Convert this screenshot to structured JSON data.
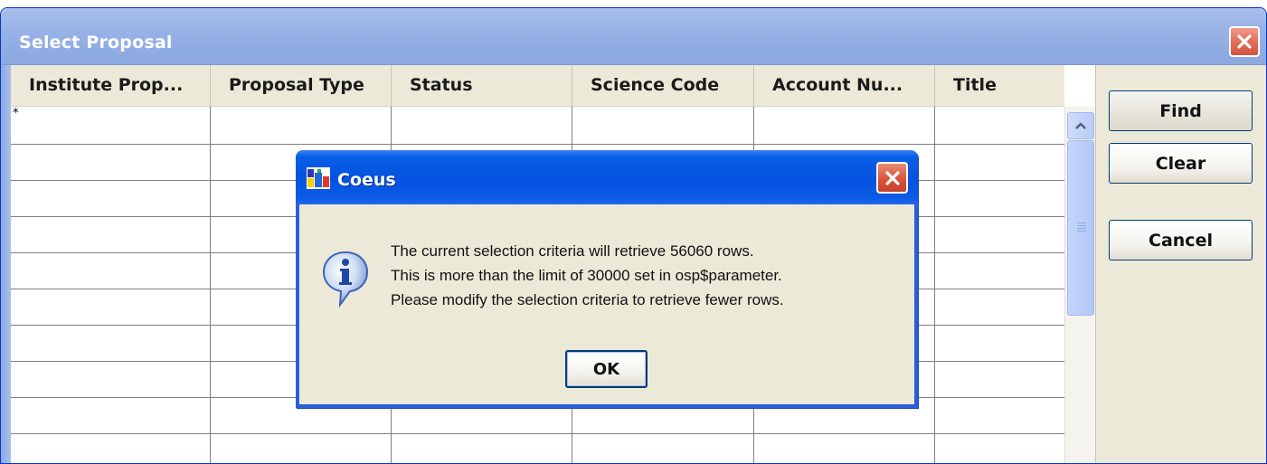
{
  "window": {
    "title": "Select Proposal"
  },
  "table": {
    "columns": [
      "Institute Prop...",
      "Proposal Type",
      "Status",
      "Science Code",
      "Account Nu...",
      "Title"
    ],
    "first_row_marker": "*"
  },
  "side_buttons": {
    "find": "Find",
    "clear": "Clear",
    "cancel": "Cancel"
  },
  "dialog": {
    "title": "Coeus",
    "icon": "info-icon",
    "lines": [
      "The current selection criteria will retrieve 56060 rows.",
      "This is more than the limit of 30000 set in osp$parameter.",
      "Please modify the selection criteria to retrieve fewer rows."
    ],
    "ok_label": "OK"
  },
  "colors": {
    "dialog_title_bar": "#0453e0",
    "window_title_bar": "#96b2e6",
    "close_button": "#d8553b",
    "background": "#ece9d8"
  }
}
